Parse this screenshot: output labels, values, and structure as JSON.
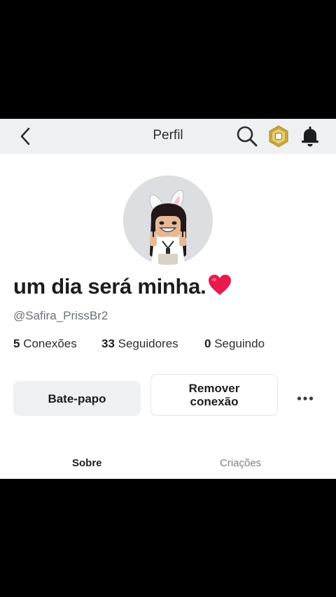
{
  "header": {
    "title": "Perfil",
    "icons": [
      "back-chevron-icon",
      "search-icon",
      "robux-icon",
      "bell-icon"
    ]
  },
  "profile": {
    "display_name": "um dia será minha.",
    "display_name_emoji": "heart-emoji",
    "username": "@Safira_PrissBr2"
  },
  "stats": {
    "connections_count": "5",
    "connections_label": "Conexões",
    "followers_count": "33",
    "followers_label": "Seguidores",
    "following_count": "0",
    "following_label": "Seguindo"
  },
  "actions": {
    "chat_label": "Bate-papo",
    "remove_line1": "Remover",
    "remove_line2": "conexão"
  },
  "tabs": [
    {
      "label": "Sobre",
      "active": true
    },
    {
      "label": "Criações",
      "active": false
    }
  ],
  "colors": {
    "letterbox": "#000000",
    "header_bg": "#eef0f2",
    "text_primary": "#1c1d1f",
    "text_secondary": "#6c7079",
    "heart": "#e8194f",
    "robux_gold": "#c9a63a"
  }
}
